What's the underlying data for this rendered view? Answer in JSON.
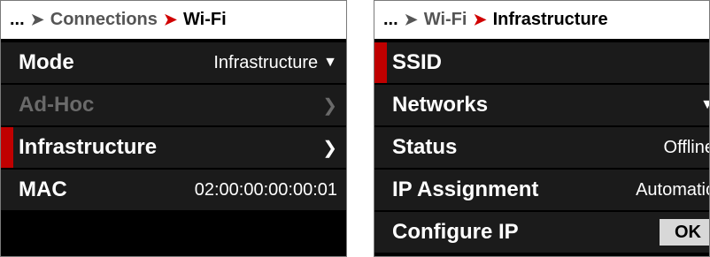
{
  "left_panel": {
    "breadcrumb": {
      "ellipsis": "...",
      "parent": "Connections",
      "current": "Wi-Fi"
    },
    "rows": [
      {
        "label": "Mode",
        "value": "Infrastructure",
        "value_icon": "caret-down-icon"
      },
      {
        "label": "Ad-Hoc",
        "value": "",
        "value_icon": "chevron-right-icon",
        "disabled": true
      },
      {
        "label": "Infrastructure",
        "value": "",
        "value_icon": "chevron-right-icon",
        "selected": true
      },
      {
        "label": "MAC",
        "value": "02:00:00:00:00:01"
      }
    ]
  },
  "right_panel": {
    "breadcrumb": {
      "ellipsis": "...",
      "parent": "Wi-Fi",
      "current": "Infrastructure"
    },
    "rows": [
      {
        "label": "SSID",
        "value": "",
        "selected": true
      },
      {
        "label": "Networks",
        "value": "",
        "value_icon": "caret-down-icon"
      },
      {
        "label": "Status",
        "value": "Offline"
      },
      {
        "label": "IP Assignment",
        "value": "Automatic"
      },
      {
        "label": "Configure IP",
        "button": "OK"
      }
    ]
  },
  "colors": {
    "accent": "#c00000",
    "background": "#000000",
    "row": "#1b1b1b",
    "header": "#ffffff"
  }
}
